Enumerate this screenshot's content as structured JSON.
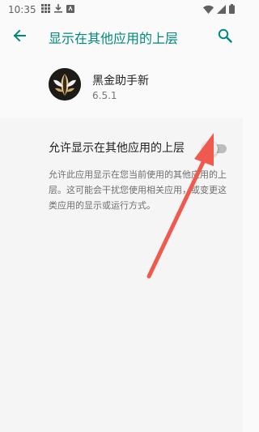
{
  "status_bar": {
    "time": "10:35"
  },
  "app_bar": {
    "title": "显示在其他应用的上层",
    "back_icon": "arrow-back-icon",
    "search_icon": "search-icon",
    "accent_color": "#00897b"
  },
  "app": {
    "name": "黑金助手新",
    "version": "6.5.1",
    "icon": "app-logo-icon"
  },
  "permission": {
    "label": "允许显示在其他应用的上层",
    "enabled": false,
    "description": "允许此应用显示在您当前使用的其他应用的上层。这可能会干扰您使用相关应用，或变更这类应用的显示或运行方式。"
  },
  "annotation": {
    "color": "#f05a4e",
    "type": "red-arrow"
  }
}
